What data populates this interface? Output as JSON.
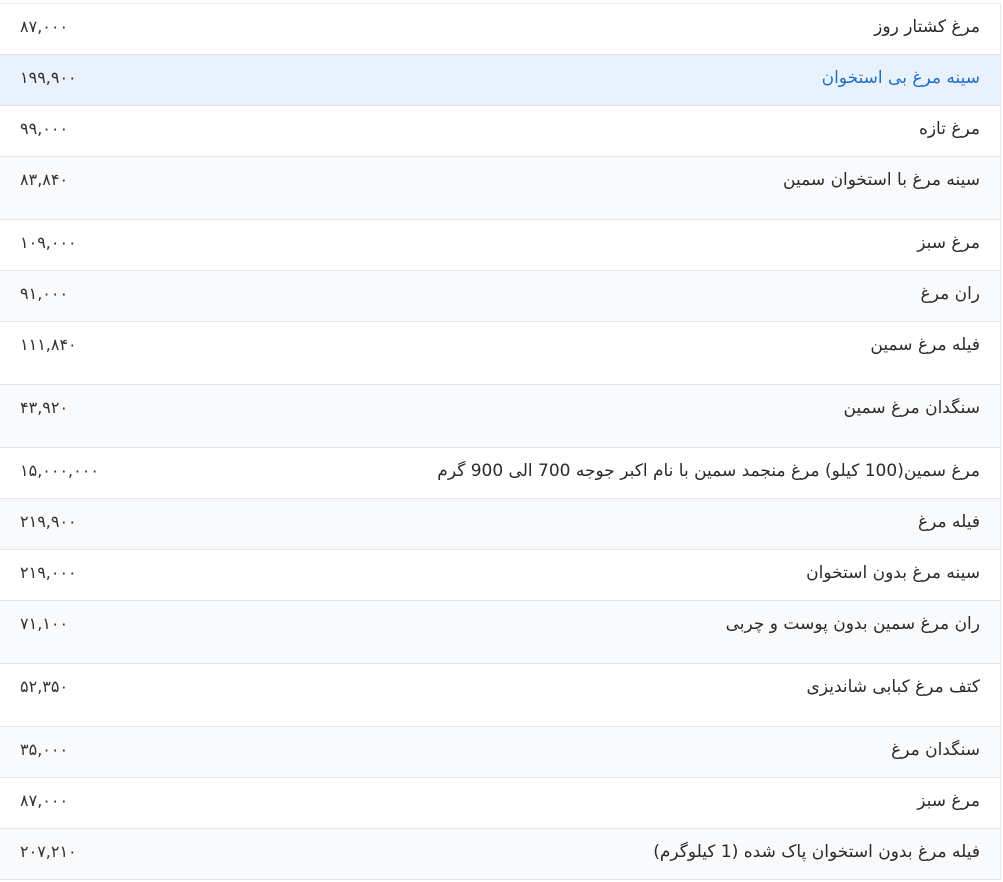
{
  "price_list": {
    "rows": [
      {
        "name": "مرغ کشتار روز",
        "price": "۸۷,۰۰۰"
      },
      {
        "name": "سینه مرغ بی استخوان",
        "price": "۱۹۹,۹۰۰"
      },
      {
        "name": "مرغ تازه",
        "price": "۹۹,۰۰۰"
      },
      {
        "name": "سینه مرغ با استخوان سمین",
        "price": "۸۳,۸۴۰"
      },
      {
        "name": "مرغ سبز",
        "price": "۱۰۹,۰۰۰"
      },
      {
        "name": "ران مرغ",
        "price": "۹۱,۰۰۰"
      },
      {
        "name": "فیله مرغ سمین",
        "price": "۱۱۱,۸۴۰"
      },
      {
        "name": "سنگدان مرغ سمین",
        "price": "۴۳,۹۲۰"
      },
      {
        "name": "مرغ سمین(100 کیلو) مرغ منجمد سمین با نام اکبر جوجه 700 الی 900 گرم",
        "price": "۱۵,۰۰۰,۰۰۰"
      },
      {
        "name": "فیله مرغ",
        "price": "۲۱۹,۹۰۰"
      },
      {
        "name": "سینه مرغ بدون استخوان",
        "price": "۲۱۹,۰۰۰"
      },
      {
        "name": "ران مرغ سمین بدون پوست و چربی",
        "price": "۷۱,۱۰۰"
      },
      {
        "name": "کتف مرغ کبابی شاندیزی",
        "price": "۵۲,۳۵۰"
      },
      {
        "name": "سنگدان مرغ",
        "price": "۳۵,۰۰۰"
      },
      {
        "name": "مرغ سبز",
        "price": "۸۷,۰۰۰"
      },
      {
        "name": "فیله مرغ بدون استخوان پاک شده (1 کیلوگرم)",
        "price": "۲۰۷,۲۱۰"
      }
    ]
  },
  "colors": {
    "highlight_background": "#e9f2fc",
    "highlight_text": "#1e6fc7",
    "alt_background": "#f9fafb",
    "border": "#e3e6ea"
  }
}
